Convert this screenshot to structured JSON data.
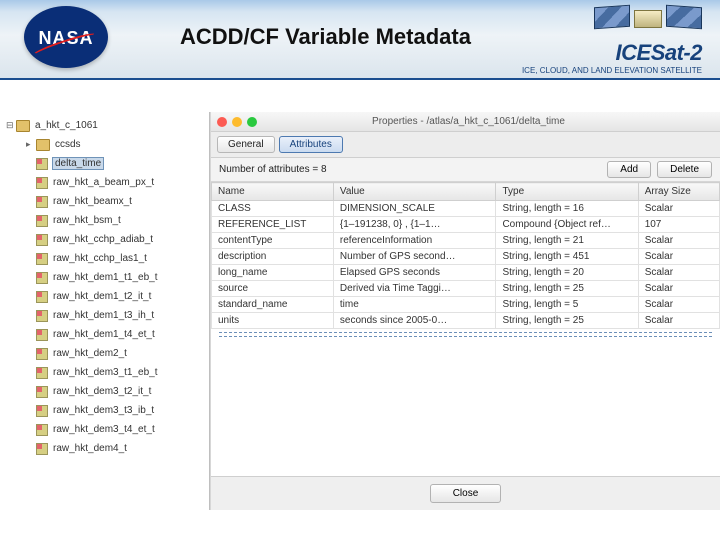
{
  "header": {
    "title": "ACDD/CF Variable Metadata",
    "mission_name": "ICESat-2",
    "mission_tagline": "ICE, CLOUD, AND LAND ELEVATION SATELLITE"
  },
  "tree": {
    "root": "a_hkt_c_1061",
    "items": [
      {
        "label": "ccsds",
        "type": "folder",
        "selected": false
      },
      {
        "label": "delta_time",
        "type": "var",
        "selected": true
      },
      {
        "label": "raw_hkt_a_beam_px_t",
        "type": "var",
        "selected": false
      },
      {
        "label": "raw_hkt_beamx_t",
        "type": "var",
        "selected": false
      },
      {
        "label": "raw_hkt_bsm_t",
        "type": "var",
        "selected": false
      },
      {
        "label": "raw_hkt_cchp_adiab_t",
        "type": "var",
        "selected": false
      },
      {
        "label": "raw_hkt_cchp_las1_t",
        "type": "var",
        "selected": false
      },
      {
        "label": "raw_hkt_dem1_t1_eb_t",
        "type": "var",
        "selected": false
      },
      {
        "label": "raw_hkt_dem1_t2_it_t",
        "type": "var",
        "selected": false
      },
      {
        "label": "raw_hkt_dem1_t3_ih_t",
        "type": "var",
        "selected": false
      },
      {
        "label": "raw_hkt_dem1_t4_et_t",
        "type": "var",
        "selected": false
      },
      {
        "label": "raw_hkt_dem2_t",
        "type": "var",
        "selected": false
      },
      {
        "label": "raw_hkt_dem3_t1_eb_t",
        "type": "var",
        "selected": false
      },
      {
        "label": "raw_hkt_dem3_t2_it_t",
        "type": "var",
        "selected": false
      },
      {
        "label": "raw_hkt_dem3_t3_ib_t",
        "type": "var",
        "selected": false
      },
      {
        "label": "raw_hkt_dem3_t4_et_t",
        "type": "var",
        "selected": false
      },
      {
        "label": "raw_hkt_dem4_t",
        "type": "var",
        "selected": false
      }
    ]
  },
  "window": {
    "title": "Properties - /atlas/a_hkt_c_1061/delta_time",
    "tabs": {
      "general": "General",
      "attributes": "Attributes"
    },
    "count_label": "Number of attributes = 8",
    "add_label": "Add",
    "delete_label": "Delete",
    "close_label": "Close"
  },
  "columns": [
    "Name",
    "Value",
    "Type",
    "Array Size"
  ],
  "rows": [
    {
      "name": "CLASS",
      "value": "DIMENSION_SCALE",
      "type": "String, length = 16",
      "size": "Scalar"
    },
    {
      "name": "REFERENCE_LIST",
      "value": "{1–191238, 0} , {1–1…",
      "type": "Compound {Object ref…",
      "size": "107"
    },
    {
      "name": "contentType",
      "value": "referenceInformation",
      "type": "String, length = 21",
      "size": "Scalar"
    },
    {
      "name": "description",
      "value": "Number of GPS second…",
      "type": "String, length = 451",
      "size": "Scalar"
    },
    {
      "name": "long_name",
      "value": "Elapsed GPS seconds",
      "type": "String, length = 20",
      "size": "Scalar"
    },
    {
      "name": "source",
      "value": "Derived via Time Taggi…",
      "type": "String, length = 25",
      "size": "Scalar"
    },
    {
      "name": "standard_name",
      "value": "time",
      "type": "String, length = 5",
      "size": "Scalar"
    },
    {
      "name": "units",
      "value": "seconds since 2005-0…",
      "type": "String, length = 25",
      "size": "Scalar"
    }
  ]
}
